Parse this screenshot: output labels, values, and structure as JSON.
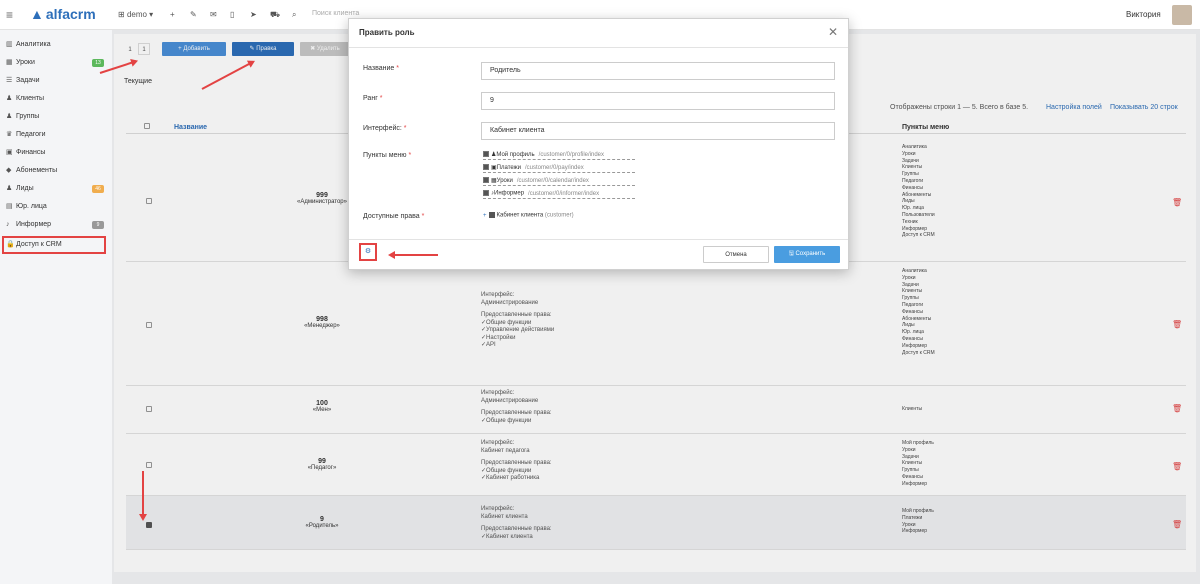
{
  "topbar": {
    "logo": "alfacrm",
    "branch": "demo",
    "search_placeholder": "Поиск клиента",
    "user_name": "Виктория"
  },
  "sidebar": {
    "items": [
      {
        "label": "Аналитика",
        "icon": "chart-icon"
      },
      {
        "label": "Уроки",
        "icon": "calendar-icon",
        "badge": "13",
        "badge_color": "#5cb85c"
      },
      {
        "label": "Задачи",
        "icon": "list-icon"
      },
      {
        "label": "Клиенты",
        "icon": "user-icon"
      },
      {
        "label": "Группы",
        "icon": "group-icon"
      },
      {
        "label": "Педагоги",
        "icon": "teacher-icon"
      },
      {
        "label": "Финансы",
        "icon": "money-icon"
      },
      {
        "label": "Абонементы",
        "icon": "tag-icon"
      },
      {
        "label": "Лиды",
        "icon": "leads-icon",
        "badge": "46",
        "badge_color": "#f0ad4e"
      },
      {
        "label": "Юр. лица",
        "icon": "building-icon"
      },
      {
        "label": "Информер",
        "icon": "bell-icon",
        "badge": "9",
        "badge_color": "#999999"
      },
      {
        "label": "Доступ к CRM",
        "icon": "lock-icon"
      }
    ]
  },
  "toolbar": {
    "page_label": "1",
    "page_value": "1",
    "add_label": "+ Добавить",
    "edit_label": "✎ Правка",
    "delete_label": "✖ Удалить"
  },
  "tabs": {
    "current": "Текущие"
  },
  "table": {
    "info": "Отображены строки 1 — 5. Всего в базе 5.",
    "settings_link": "Настройка полей",
    "per_page": "Показывать 20 строк",
    "col_name": "Название",
    "col_menu": "Пункты меню",
    "rows": [
      {
        "code": "999",
        "role": "«Администратор»",
        "iface": [],
        "menu": [
          "Аналитика",
          "Уроки",
          "Задачи",
          "Клиенты",
          "Группы",
          "Педагоги",
          "Финансы",
          "Абонементы",
          "Лиды",
          "Юр. лица",
          "Пользователи",
          "Техник",
          "Информер",
          "Доступ к CRM"
        ]
      },
      {
        "code": "998",
        "role": "«Менеджер»",
        "iface": [
          "Интерфейс:",
          "Администрирование",
          "",
          "Предоставленные права:",
          "✓Общие функции",
          "✓Управление действиями",
          "✓Настройки",
          "✓API"
        ],
        "menu": [
          "Аналитика",
          "Уроки",
          "Задачи",
          "Клиенты",
          "Группы",
          "Педагоги",
          "Финансы",
          "Абонементы",
          "Лиды",
          "Юр. лица",
          "Финансы",
          "Информер",
          "Доступ к CRM"
        ]
      },
      {
        "code": "100",
        "role": "«Мен»",
        "iface": [
          "Интерфейс:",
          "Администрирование",
          "",
          "Предоставленные права:",
          "✓Общие функции"
        ],
        "menu": [
          "Клиенты"
        ]
      },
      {
        "code": "99",
        "role": "«Педагог»",
        "iface": [
          "Интерфейс:",
          "Кабинет педагога",
          "",
          "Предоставленные права:",
          "✓Общие функции",
          "✓Кабинет работника"
        ],
        "menu": [
          "Мой профиль",
          "Уроки",
          "Задачи",
          "Клиенты",
          "Группы",
          "Финансы",
          "Информер"
        ]
      },
      {
        "code": "9",
        "role": "«Родитель»",
        "iface": [
          "Интерфейс:",
          "Кабинет клиента",
          "",
          "Предоставленные права:",
          "✓Кабинет клиента"
        ],
        "menu": [
          "Мой профиль",
          "Платежи",
          "Уроки",
          "Информер"
        ]
      }
    ]
  },
  "modal": {
    "title": "Править роль",
    "name_label": "Название",
    "name_value": "Родитель",
    "rank_label": "Ранг",
    "rank_value": "9",
    "iface_label": "Интерфейс:",
    "iface_value": "Кабинет клиента",
    "menu_label": "Пункты меню",
    "menu_items": [
      {
        "label": "Мой профиль",
        "path": "/customer/0/profile/index"
      },
      {
        "label": "Платежи",
        "path": "/customer/0/pay/index"
      },
      {
        "label": "Уроки",
        "path": "/customer/0/calendar/index"
      },
      {
        "label": "Информер",
        "path": "/customer/0/informer/index"
      }
    ],
    "perm_label": "Доступные права",
    "perm_value": "Кабинет клиента",
    "perm_code": "(customer)",
    "cancel_label": "Отмена",
    "save_label": "🖫 Сохранить"
  },
  "colors": {
    "accent": "#2d6fba",
    "highlight": "#e34343",
    "save": "#4a9de0"
  }
}
